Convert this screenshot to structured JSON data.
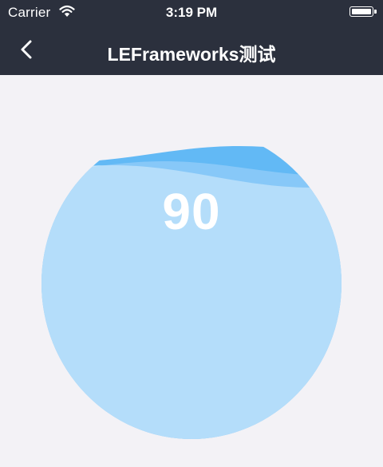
{
  "status_bar": {
    "carrier": "Carrier",
    "time": "3:19 PM",
    "wifi_icon": "wifi-icon",
    "battery_icon": "battery-icon"
  },
  "nav": {
    "title": "LEFrameworks测试",
    "back_icon": "chevron-left-icon"
  },
  "gauge": {
    "value": "90",
    "fill_level": 0.9
  },
  "colors": {
    "nav_background": "#2b303d",
    "page_background": "#f3f2f6",
    "wave_light": "#c6e6fb",
    "wave_mid": "#a6d6fa",
    "wave_dark": "#62b9f5",
    "value_text": "#ffffff"
  }
}
